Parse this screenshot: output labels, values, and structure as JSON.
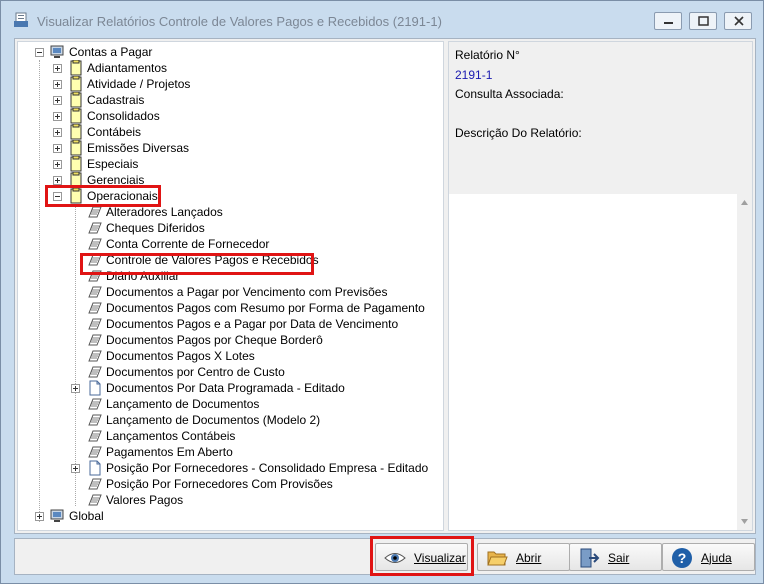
{
  "window": {
    "title": "Visualizar Relatórios Controle de Valores Pagos e Recebidos (2191-1)"
  },
  "tree": {
    "root": "Contas a Pagar",
    "categories": [
      "Adiantamentos",
      "Atividade / Projetos",
      "Cadastrais",
      "Consolidados",
      "Contábeis",
      "Emissões Diversas",
      "Especiais",
      "Gerenciais"
    ],
    "open_category": "Operacionais",
    "reports": [
      "Alteradores Lançados",
      "Cheques Diferidos",
      "Conta Corrente de Fornecedor",
      "Controle de Valores Pagos e Recebidos",
      "Diário Auxiliar",
      "Documentos a Pagar por Vencimento com Previsões",
      "Documentos Pagos com Resumo por Forma de Pagamento",
      "Documentos Pagos e a Pagar por Data de Vencimento",
      "Documentos Pagos por Cheque Borderô",
      "Documentos Pagos X Lotes",
      "Documentos por Centro de Custo",
      "Documentos Por Data Programada - Editado",
      "Lançamento de Documentos",
      "Lançamento de Documentos (Modelo 2)",
      "Lançamentos Contábeis",
      "Pagamentos Em Aberto",
      "Posição Por Fornecedores - Consolidado Empresa - Editado",
      "Posição Por Fornecedores Com Provisões",
      "Valores Pagos"
    ],
    "second_root": "Global"
  },
  "info": {
    "report_no_label": "Relatório N°",
    "report_no_value": "2191-1",
    "consulta_label": "Consulta Associada:",
    "descricao_label": "Descrição Do Relatório:"
  },
  "buttons": {
    "visualizar": "Visualizar",
    "abrir": "Abrir",
    "sair": "Sair",
    "ajuda": "Ajuda"
  },
  "colors": {
    "highlight": "#e01414",
    "link_value": "#1a1ab0"
  }
}
